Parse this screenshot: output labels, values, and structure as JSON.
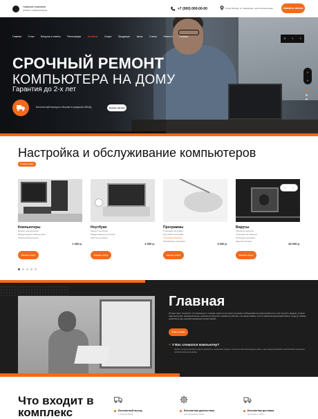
{
  "header": {
    "logo_name": "Название компании",
    "logo_sub": "ремонт компьютеров",
    "phone": "+7 (000) 000-00-00",
    "address": "Город Москва, ул. Заводская, дом Компьютерная",
    "call_button": "Заказать звонок"
  },
  "nav": {
    "items": [
      "Главная",
      "О нас",
      "Вопросы и ответы",
      "Регистрация",
      "Контакты",
      "Услуги",
      "Продукция",
      "Цены",
      "Статьи",
      "Новости",
      "Галерея"
    ],
    "active_index": 4
  },
  "hero": {
    "title_line1": "СРОЧНЫЙ РЕМОНТ",
    "title_line2": "КОМПЬЮТЕРА НА ДОМУ",
    "title_line3": "Гарантия до 2-х лет",
    "free_text": "Бесплатный выезд по Москве в пределах МКАД",
    "button": "Вызвать мастера"
  },
  "services": {
    "title": "Настройка и обслуживание компьютеров",
    "badge": "Создать услугу",
    "cards": [
      {
        "name": "Компьютеры",
        "lines": [
          "Ремонт компьютеров",
          "Модернизация компьютеров",
          "Сборка компьютеров"
        ],
        "highlight": -1,
        "price": "1 000 р.",
        "button": "Заказать услугу"
      },
      {
        "name": "Ноутбуки",
        "lines": [
          "Ремонт ноутбуков",
          "Модернизация ноутбуков",
          "Чистка ноутбуков"
        ],
        "highlight": -1,
        "price": "2 000 р.",
        "button": "Заказать услугу"
      },
      {
        "name": "Программы",
        "lines": [
          "Установка программ",
          "Настройка программ",
          "Установка Windows",
          "Обновление программ"
        ],
        "highlight": 2,
        "price": "3 000 р.",
        "button": "Заказать услугу"
      },
      {
        "name": "Вирусы",
        "lines": [
          "Удаление вирусов",
          "Установка антивируса",
          "Проверка на вирусы",
          "Защита системы"
        ],
        "highlight": -1,
        "price": "45 000 р.",
        "button": "Заказать услугу"
      }
    ]
  },
  "about": {
    "title": "Главная",
    "text": "Отныне часто случается, что компьютер в то время, когда он так нужен срочными сообщениями на электронной почте, или получить задание, которое надо выполнить незамедлительно, компьютер перестает нормально работать. Не менее обидно, если в самый неподходящий момент, когда до победы урона было уже, выходил машинный потери мышей.",
    "button": "Узнать больше",
    "question": "У Вас сломался компьютер?",
    "answer": "Звоните в нашу компанию, наши специалисты оперативно приедут и выполнят всю необходимую работу и вне пределов МКАД по всей Москве на высоком профессиональном уровне."
  },
  "included": {
    "title_line1": "Что входит в",
    "title_line2": "комплекс",
    "features": [
      {
        "icon": "truck-icon",
        "name": "Бесплатный выезд",
        "sub": "в пределах МКАД"
      },
      {
        "icon": "gear-icon",
        "name": "Бесплатная диагностика",
        "sub": "при оформлении заказа"
      },
      {
        "icon": "delivery-icon",
        "name": "Бесплатная доставка",
        "sub": "при заказе от 3000 р."
      }
    ]
  },
  "colors": {
    "accent": "#f26a1b",
    "dark": "#1d1d1d"
  }
}
